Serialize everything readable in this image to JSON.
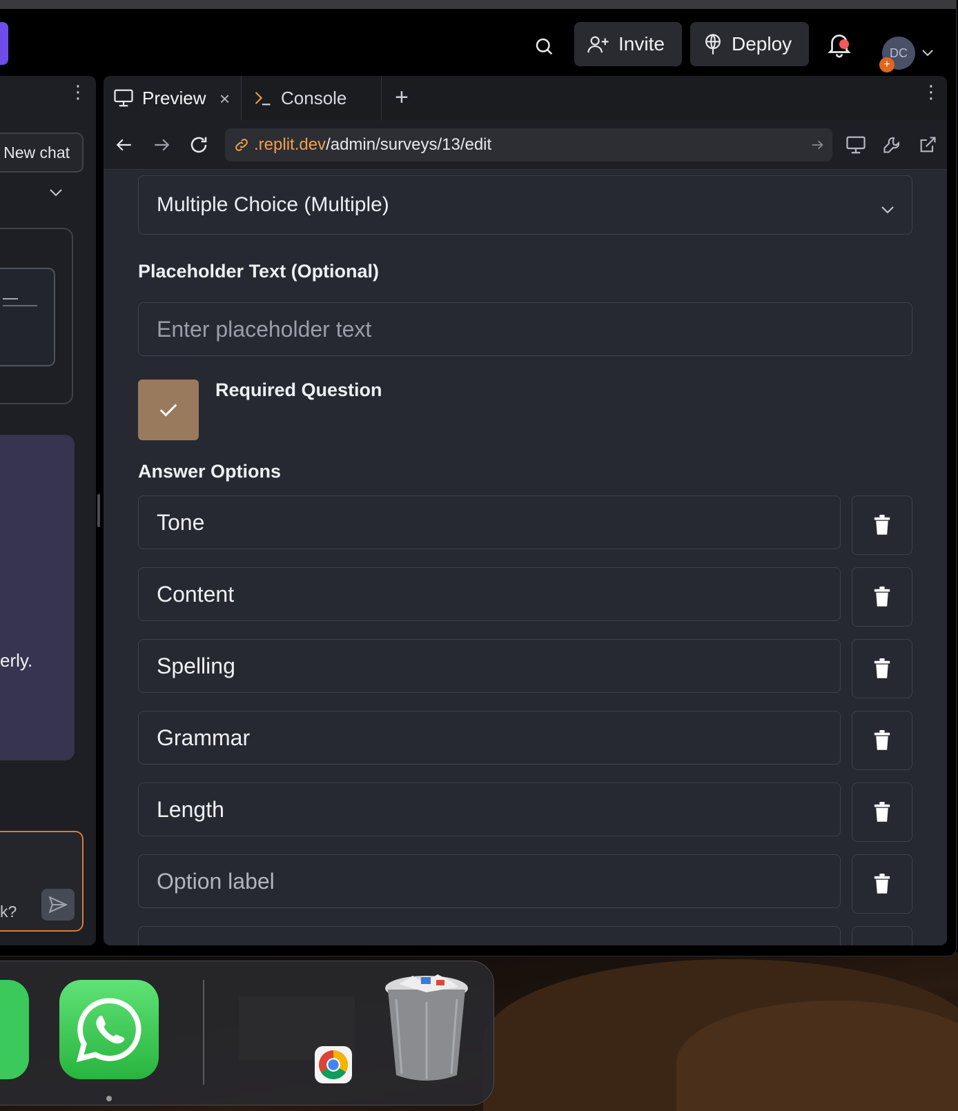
{
  "topbar": {
    "invite_label": "Invite",
    "deploy_label": "Deploy",
    "avatar_initials": "DC"
  },
  "left_panel": {
    "new_chat_label": "New chat",
    "bubble_tail_text": "erly.",
    "input_tail_text": "k?"
  },
  "tabs": {
    "preview_label": "Preview",
    "console_label": "Console"
  },
  "url": {
    "host": ".replit.dev",
    "path": "/admin/surveys/13/edit"
  },
  "form": {
    "question_type": "Multiple Choice (Multiple)",
    "placeholder_label": "Placeholder Text (Optional)",
    "placeholder_input_placeholder": "Enter placeholder text",
    "required_label": "Required Question",
    "required_checked": true,
    "answer_options_label": "Answer Options",
    "options": [
      {
        "value": "Tone"
      },
      {
        "value": "Content"
      },
      {
        "value": "Spelling"
      },
      {
        "value": "Grammar"
      },
      {
        "value": "Length"
      },
      {
        "placeholder": "Option label"
      }
    ]
  },
  "colors": {
    "accent_brand": "#6f4de8",
    "checkbox": "#9a7a5c",
    "url_host": "#f2a04a",
    "chat_input_border": "#e07a32",
    "notification_dot": "#f05a5a"
  },
  "icons": [
    "search-icon",
    "add-user-icon",
    "deploy-icon",
    "bell-icon",
    "chevron-down-icon",
    "monitor-icon",
    "close-icon",
    "terminal-icon",
    "plus-icon",
    "kebab-icon",
    "arrow-left-icon",
    "arrow-right-icon",
    "refresh-icon",
    "link-icon",
    "wrench-icon",
    "external-link-icon",
    "check-icon",
    "trash-icon",
    "send-icon"
  ]
}
